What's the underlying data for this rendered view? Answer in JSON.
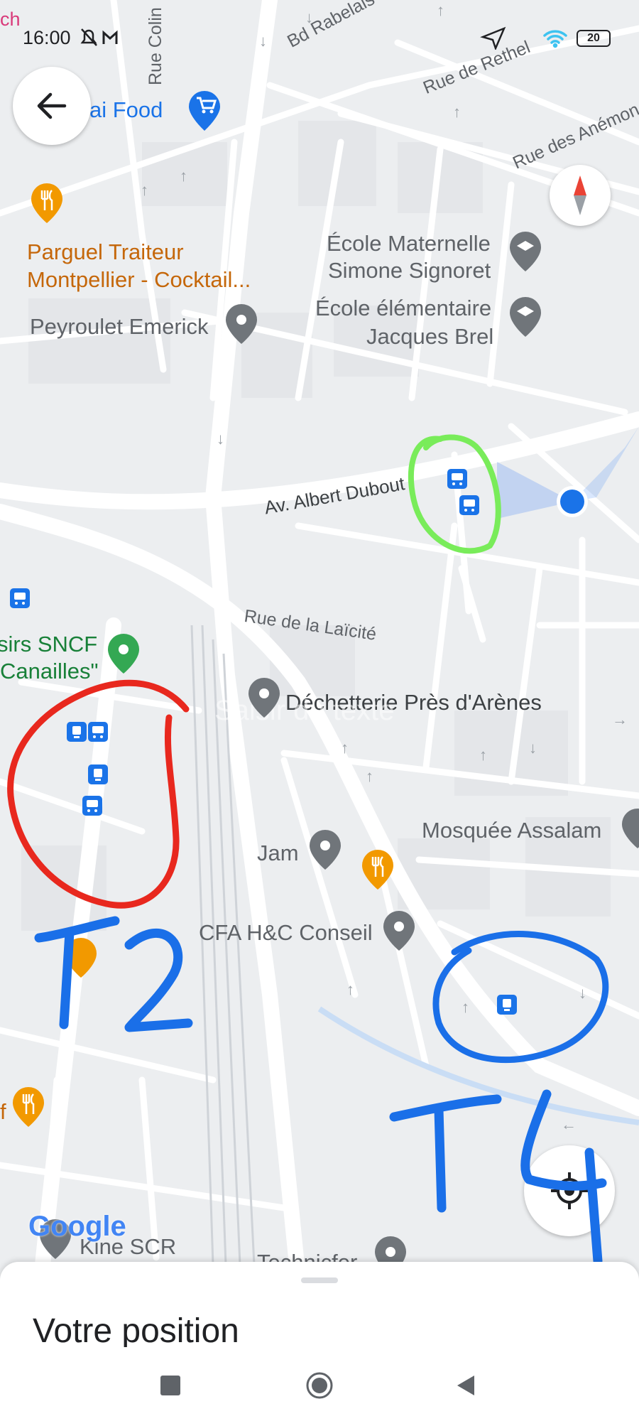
{
  "status_bar": {
    "time": "16:00",
    "battery": "20"
  },
  "map": {
    "pois": {
      "food_store": "ai Food",
      "parguel_line1": "Parguel Traiteur",
      "parguel_line2": "Montpellier -  Cocktail...",
      "peyroulet": "Peyroulet Emerick",
      "ecole_maternelle_line1": "École Maternelle",
      "ecole_maternelle_line2": "Simone Signoret",
      "ecole_elementaire_line1": "École élémentaire",
      "ecole_elementaire_line2": "Jacques Brel",
      "sncf_line1": "sirs SNCF",
      "sncf_line2": "Canailles\"",
      "decheterie": "Déchetterie Près d'Arènes",
      "mosquee": "Mosquée Assalam",
      "jam": "Jam",
      "cfa": "CFA H&C Conseil",
      "kine": "Kine SCR",
      "technicfer": "Technicfer",
      "partial_f": "f",
      "partial_ch": "ch"
    },
    "streets": {
      "bd_rabelais": "Bd Rabelais",
      "rue_colin": "Rue Colin",
      "rue_de_rethel": "Rue de Rethel",
      "rue_des_anemones": "Rue des Anémon",
      "av_albert_dubout": "Av. Albert Dubout",
      "rue_laicite": "Rue de la Laïcité"
    },
    "watermark": "Saisir du texte",
    "google_logo": "Google"
  },
  "annotations": {
    "t2": "T2",
    "t4": "T4",
    "colors": {
      "red": "#e8281e",
      "blue": "#1a6fe8",
      "green": "#79ec5a"
    }
  },
  "bottom_sheet": {
    "title": "Votre position"
  },
  "colors": {
    "map_bg": "#eceef0",
    "road": "#ffffff",
    "transit_icon": "#1a73e8",
    "food_pin": "#f29900",
    "poi_pin": "#70757a",
    "location_dot": "#1a73e8"
  },
  "icons": [
    "back-arrow-icon",
    "compass-icon",
    "my-location-icon",
    "bus-stop-icon",
    "tram-stop-icon",
    "restaurant-pin-icon",
    "shopping-cart-pin-icon",
    "school-pin-icon",
    "place-pin-icon",
    "green-pin-icon",
    "location-dot-icon",
    "square-nav-icon",
    "circle-nav-icon",
    "triangle-back-nav-icon"
  ]
}
